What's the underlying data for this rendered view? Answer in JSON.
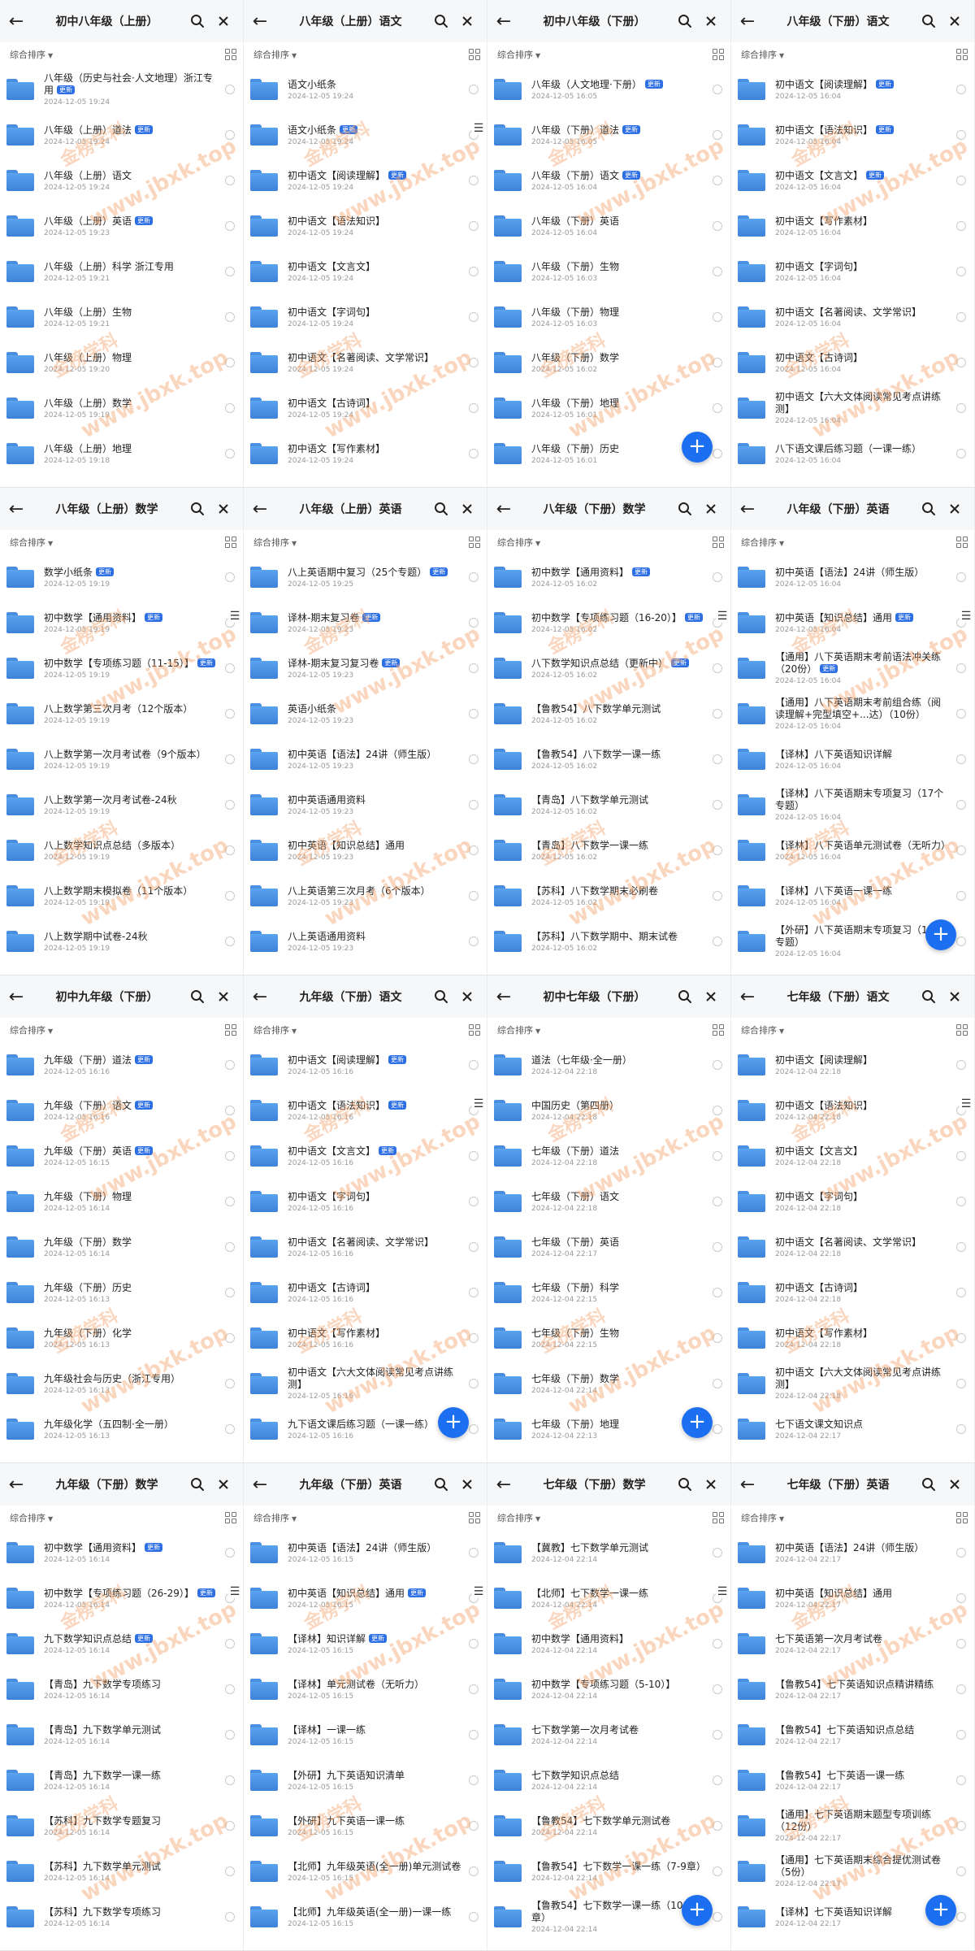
{
  "sort_label": "综合排序",
  "new_badge": "更新",
  "watermark": {
    "primary": "金榜学科",
    "secondary": "www.jbxk.top"
  },
  "panels": [
    {
      "title": "初中八年级（上册）",
      "fab": false,
      "menu": false,
      "items": [
        {
          "name": "八年级（历史与社会·人文地理）浙江专用",
          "date": "2024-12-05 19:24",
          "badge": true
        },
        {
          "name": "八年级（上册）道法",
          "date": "2024-12-05 19:24",
          "badge": true
        },
        {
          "name": "八年级（上册）语文",
          "date": "2024-12-05 19:24",
          "badge": false
        },
        {
          "name": "八年级（上册）英语",
          "date": "2024-12-05 19:23",
          "badge": true
        },
        {
          "name": "八年级（上册）科学 浙江专用",
          "date": "2024-12-05 19:21",
          "badge": false
        },
        {
          "name": "八年级（上册）生物",
          "date": "2024-12-05 19:21",
          "badge": false
        },
        {
          "name": "八年级（上册）物理",
          "date": "2024-12-05 19:20",
          "badge": false
        },
        {
          "name": "八年级（上册）数学",
          "date": "2024-12-05 19:19",
          "badge": false
        },
        {
          "name": "八年级（上册）地理",
          "date": "2024-12-05 19:18",
          "badge": false
        }
      ]
    },
    {
      "title": "八年级（上册）语文",
      "fab": false,
      "menu": true,
      "items": [
        {
          "name": "语文小纸条",
          "date": "2024-12-05 19:24",
          "badge": false
        },
        {
          "name": "语文小纸条",
          "date": "2024-12-05 19:24",
          "badge": true
        },
        {
          "name": "初中语文【阅读理解】",
          "date": "2024-12-05 19:24",
          "badge": true
        },
        {
          "name": "初中语文【语法知识】",
          "date": "2024-12-05 19:24",
          "badge": false
        },
        {
          "name": "初中语文【文言文】",
          "date": "2024-12-05 19:24",
          "badge": false
        },
        {
          "name": "初中语文【字词句】",
          "date": "2024-12-05 19:24",
          "badge": false
        },
        {
          "name": "初中语文【名著阅读、文学常识】",
          "date": "2024-12-05 19:24",
          "badge": false
        },
        {
          "name": "初中语文【古诗词】",
          "date": "2024-12-05 19:24",
          "badge": false
        },
        {
          "name": "初中语文【写作素材】",
          "date": "2024-12-05 19:24",
          "badge": false
        }
      ]
    },
    {
      "title": "初中八年级（下册）",
      "fab": true,
      "menu": false,
      "items": [
        {
          "name": "八年级（人文地理·下册）",
          "date": "2024-12-05 16:05",
          "badge": true
        },
        {
          "name": "八年级（下册）道法",
          "date": "2024-12-05 16:05",
          "badge": true
        },
        {
          "name": "八年级（下册）语文",
          "date": "2024-12-05 16:04",
          "badge": true
        },
        {
          "name": "八年级（下册）英语",
          "date": "2024-12-05 16:04",
          "badge": false
        },
        {
          "name": "八年级（下册）生物",
          "date": "2024-12-05 16:03",
          "badge": false
        },
        {
          "name": "八年级（下册）物理",
          "date": "2024-12-05 16:03",
          "badge": false
        },
        {
          "name": "八年级（下册）数学",
          "date": "2024-12-05 16:02",
          "badge": false
        },
        {
          "name": "八年级（下册）地理",
          "date": "2024-12-05 16:01",
          "badge": false
        },
        {
          "name": "八年级（下册）历史",
          "date": "2024-12-05 16:01",
          "badge": false
        }
      ]
    },
    {
      "title": "八年级（下册）语文",
      "fab": false,
      "menu": false,
      "items": [
        {
          "name": "初中语文【阅读理解】",
          "date": "2024-12-05 16:04",
          "badge": true
        },
        {
          "name": "初中语文【语法知识】",
          "date": "2024-12-05 16:04",
          "badge": true
        },
        {
          "name": "初中语文【文言文】",
          "date": "2024-12-05 16:04",
          "badge": true
        },
        {
          "name": "初中语文【写作素材】",
          "date": "2024-12-05 16:04",
          "badge": false
        },
        {
          "name": "初中语文【字词句】",
          "date": "2024-12-05 16:04",
          "badge": false
        },
        {
          "name": "初中语文【名著阅读、文学常识】",
          "date": "2024-12-05 16:04",
          "badge": false
        },
        {
          "name": "初中语文【古诗词】",
          "date": "2024-12-05 16:04",
          "badge": false
        },
        {
          "name": "初中语文【六大文体阅读常见考点讲练测】",
          "date": "2024-12-05 16:04",
          "badge": false
        },
        {
          "name": "八下语文课后练习题（一课一练）",
          "date": "2024-12-05 16:04",
          "badge": false
        }
      ]
    },
    {
      "title": "八年级（上册）数学",
      "fab": false,
      "menu": true,
      "items": [
        {
          "name": "数学小纸条",
          "date": "2024-12-05 19:19",
          "badge": true
        },
        {
          "name": "初中数学【通用资料】",
          "date": "2024-12-05 19:19",
          "badge": true
        },
        {
          "name": "初中数学【专项练习题（11-15）】",
          "date": "2024-12-05 19:19",
          "badge": true
        },
        {
          "name": "八上数学第三次月考（12个版本）",
          "date": "2024-12-05 19:19",
          "badge": false
        },
        {
          "name": "八上数学第一次月考试卷（9个版本）",
          "date": "2024-12-05 19:19",
          "badge": false
        },
        {
          "name": "八上数学第一次月考试卷-24秋",
          "date": "2024-12-05 19:19",
          "badge": false
        },
        {
          "name": "八上数学知识点总结（多版本）",
          "date": "2024-12-05 19:19",
          "badge": false
        },
        {
          "name": "八上数学期末模拟卷（11个版本）",
          "date": "2024-12-05 19:19",
          "badge": false
        },
        {
          "name": "八上数学期中试卷-24秋",
          "date": "2024-12-05 19:19",
          "badge": false
        }
      ]
    },
    {
      "title": "八年级（上册）英语",
      "fab": false,
      "menu": false,
      "items": [
        {
          "name": "八上英语期中复习（25个专题）",
          "date": "2024-12-05 19:25",
          "badge": true
        },
        {
          "name": "译林-期末复习卷",
          "date": "2024-12-05 19:23",
          "badge": true
        },
        {
          "name": "译林-期末复习复习卷",
          "date": "2024-12-05 19:23",
          "badge": true
        },
        {
          "name": "英语小纸条",
          "date": "2024-12-05 19:23",
          "badge": false
        },
        {
          "name": "初中英语【语法】24讲（师生版）",
          "date": "2024-12-05 19:23",
          "badge": false
        },
        {
          "name": "初中英语通用资料",
          "date": "2024-12-05 19:23",
          "badge": false
        },
        {
          "name": "初中英语【知识总结】通用",
          "date": "2024-12-05 19:23",
          "badge": false
        },
        {
          "name": "八上英语第三次月考（6个版本）",
          "date": "2024-12-05 19:23",
          "badge": false
        },
        {
          "name": "八上英语通用资料",
          "date": "2024-12-05 19:23",
          "badge": false
        }
      ]
    },
    {
      "title": "八年级（下册）数学",
      "fab": false,
      "menu": true,
      "items": [
        {
          "name": "初中数学【通用资料】",
          "date": "2024-12-05 16:02",
          "badge": true
        },
        {
          "name": "初中数学【专项练习题（16-20）】",
          "date": "2024-12-05 16:02",
          "badge": true
        },
        {
          "name": "八下数学知识点总结（更新中）",
          "date": "2024-12-05 16:02",
          "badge": true
        },
        {
          "name": "【鲁教54】八下数学单元测试",
          "date": "2024-12-05 16:02",
          "badge": false
        },
        {
          "name": "【鲁教54】八下数学一课一练",
          "date": "2024-12-05 16:02",
          "badge": false
        },
        {
          "name": "【青岛】八下数学单元测试",
          "date": "2024-12-05 16:02",
          "badge": false
        },
        {
          "name": "【青岛】八下数学一课一练",
          "date": "2024-12-05 16:02",
          "badge": false
        },
        {
          "name": "【苏科】八下数学期末必刷卷",
          "date": "2024-12-05 16:02",
          "badge": false
        },
        {
          "name": "【苏科】八下数学期中、期末试卷",
          "date": "2024-12-05 16:02",
          "badge": false
        }
      ]
    },
    {
      "title": "八年级（下册）英语",
      "fab": true,
      "menu": true,
      "items": [
        {
          "name": "初中英语【语法】24讲（师生版）",
          "date": "2024-12-05 16:04",
          "badge": false
        },
        {
          "name": "初中英语【知识总结】通用",
          "date": "2024-12-05 16:04",
          "badge": true
        },
        {
          "name": "【通用】八下英语期末考前语法冲关练（20份）",
          "date": "2024-12-05 16:04",
          "badge": true
        },
        {
          "name": "【通用】八下英语期末考前组合练（阅读理解+完型填空+...达）（10份）",
          "date": "2024-12-05 16:04",
          "badge": false
        },
        {
          "name": "【译林】八下英语知识详解",
          "date": "2024-12-05 16:04",
          "badge": false
        },
        {
          "name": "【译林】八下英语期末专项复习（17个专题）",
          "date": "2024-12-05 16:04",
          "badge": false
        },
        {
          "name": "【译林】八下英语单元测试卷（无听力）",
          "date": "2024-12-05 16:04",
          "badge": false
        },
        {
          "name": "【译林】八下英语一课一练",
          "date": "2024-12-05 16:04",
          "badge": false
        },
        {
          "name": "【外研】八下英语期末专项复习（16个专题）",
          "date": "2024-12-05 16:04",
          "badge": false
        }
      ]
    },
    {
      "title": "初中九年级（下册）",
      "fab": false,
      "menu": false,
      "items": [
        {
          "name": "九年级（下册）道法",
          "date": "2024-12-05 16:16",
          "badge": true
        },
        {
          "name": "九年级（下册）语文",
          "date": "2024-12-05 16:16",
          "badge": true
        },
        {
          "name": "九年级（下册）英语",
          "date": "2024-12-05 16:15",
          "badge": true
        },
        {
          "name": "九年级（下册）物理",
          "date": "2024-12-05 16:14",
          "badge": false
        },
        {
          "name": "九年级（下册）数学",
          "date": "2024-12-05 16:14",
          "badge": false
        },
        {
          "name": "九年级（下册）历史",
          "date": "2024-12-05 16:13",
          "badge": false
        },
        {
          "name": "九年级（下册）化学",
          "date": "2024-12-05 16:13",
          "badge": false
        },
        {
          "name": "九年级社会与历史（浙江专用）",
          "date": "2024-12-05 16:13",
          "badge": false
        },
        {
          "name": "九年级化学（五四制·全一册）",
          "date": "2024-12-05 16:13",
          "badge": false
        }
      ]
    },
    {
      "title": "九年级（下册）语文",
      "fab": true,
      "menu": true,
      "items": [
        {
          "name": "初中语文【阅读理解】",
          "date": "2024-12-05 16:16",
          "badge": true
        },
        {
          "name": "初中语文【语法知识】",
          "date": "2024-12-05 16:16",
          "badge": true
        },
        {
          "name": "初中语文【文言文】",
          "date": "2024-12-05 16:16",
          "badge": true
        },
        {
          "name": "初中语文【字词句】",
          "date": "2024-12-05 16:16",
          "badge": false
        },
        {
          "name": "初中语文【名著阅读、文学常识】",
          "date": "2024-12-05 16:16",
          "badge": false
        },
        {
          "name": "初中语文【古诗词】",
          "date": "2024-12-05 16:16",
          "badge": false
        },
        {
          "name": "初中语文【写作素材】",
          "date": "2024-12-05 16:16",
          "badge": false
        },
        {
          "name": "初中语文【六大文体阅读常见考点讲练测】",
          "date": "2024-12-05 16:16",
          "badge": false
        },
        {
          "name": "九下语文课后练习题（一课一练）",
          "date": "2024-12-05 16:16",
          "badge": false
        }
      ]
    },
    {
      "title": "初中七年级（下册）",
      "fab": true,
      "menu": false,
      "items": [
        {
          "name": "道法（七年级·全一册）",
          "date": "2024-12-04 22:18",
          "badge": false
        },
        {
          "name": "中国历史（第四册）",
          "date": "2024-12-04 22:18",
          "badge": false
        },
        {
          "name": "七年级（下册）道法",
          "date": "2024-12-04 22:18",
          "badge": false
        },
        {
          "name": "七年级（下册）语文",
          "date": "2024-12-04 22:18",
          "badge": false
        },
        {
          "name": "七年级（下册）英语",
          "date": "2024-12-04 22:17",
          "badge": false
        },
        {
          "name": "七年级（下册）科学",
          "date": "2024-12-04 22:15",
          "badge": false
        },
        {
          "name": "七年级（下册）生物",
          "date": "2024-12-04 22:15",
          "badge": false
        },
        {
          "name": "七年级（下册）数学",
          "date": "2024-12-04 22:14",
          "badge": false
        },
        {
          "name": "七年级（下册）地理",
          "date": "2024-12-04 22:13",
          "badge": false
        }
      ]
    },
    {
      "title": "七年级（下册）语文",
      "fab": false,
      "menu": true,
      "items": [
        {
          "name": "初中语文【阅读理解】",
          "date": "2024-12-04 22:18",
          "badge": false
        },
        {
          "name": "初中语文【语法知识】",
          "date": "2024-12-04 22:18",
          "badge": false
        },
        {
          "name": "初中语文【文言文】",
          "date": "2024-12-04 22:18",
          "badge": false
        },
        {
          "name": "初中语文【字词句】",
          "date": "2024-12-04 22:18",
          "badge": false
        },
        {
          "name": "初中语文【名著阅读、文学常识】",
          "date": "2024-12-04 22:18",
          "badge": false
        },
        {
          "name": "初中语文【古诗词】",
          "date": "2024-12-04 22:18",
          "badge": false
        },
        {
          "name": "初中语文【写作素材】",
          "date": "2024-12-04 22:18",
          "badge": false
        },
        {
          "name": "初中语文【六大文体阅读常见考点讲练测】",
          "date": "2024-12-04 22:18",
          "badge": false
        },
        {
          "name": "七下语文课文知识点",
          "date": "2024-12-04 22:17",
          "badge": false
        }
      ]
    },
    {
      "title": "九年级（下册）数学",
      "fab": false,
      "menu": true,
      "items": [
        {
          "name": "初中数学【通用资料】",
          "date": "2024-12-05 16:14",
          "badge": true
        },
        {
          "name": "初中数学【专项练习题（26-29）】",
          "date": "2024-12-05 16:14",
          "badge": true
        },
        {
          "name": "九下数学知识点总结",
          "date": "2024-12-05 16:14",
          "badge": true
        },
        {
          "name": "【青岛】九下数学专项练习",
          "date": "2024-12-05 16:14",
          "badge": false
        },
        {
          "name": "【青岛】九下数学单元测试",
          "date": "2024-12-05 16:14",
          "badge": false
        },
        {
          "name": "【青岛】九下数学一课一练",
          "date": "2024-12-05 16:14",
          "badge": false
        },
        {
          "name": "【苏科】九下数学专题复习",
          "date": "2024-12-05 16:14",
          "badge": false
        },
        {
          "name": "【苏科】九下数学单元测试",
          "date": "2024-12-05 16:14",
          "badge": false
        },
        {
          "name": "【苏科】九下数学专项练习",
          "date": "2024-12-05 16:14",
          "badge": false
        }
      ]
    },
    {
      "title": "九年级（下册）英语",
      "fab": false,
      "menu": true,
      "items": [
        {
          "name": "初中英语【语法】24讲（师生版）",
          "date": "2024-12-05 16:15",
          "badge": false
        },
        {
          "name": "初中英语【知识总结】通用",
          "date": "2024-12-05 16:15",
          "badge": true
        },
        {
          "name": "【译林】知识详解",
          "date": "2024-12-05 16:15",
          "badge": true
        },
        {
          "name": "【译林】单元测试卷（无听力）",
          "date": "2024-12-05 16:15",
          "badge": false
        },
        {
          "name": "【译林】一课一练",
          "date": "2024-12-05 16:15",
          "badge": false
        },
        {
          "name": "【外研】九下英语知识清单",
          "date": "2024-12-05 16:15",
          "badge": false
        },
        {
          "name": "【外研】九下英语一课一练",
          "date": "2024-12-05 16:15",
          "badge": false
        },
        {
          "name": "【北师】九年级英语(全一册)单元测试卷",
          "date": "2024-12-05 16:15",
          "badge": false
        },
        {
          "name": "【北师】九年级英语(全一册)一课一练",
          "date": "2024-12-05 16:15",
          "badge": false
        }
      ]
    },
    {
      "title": "七年级（下册）数学",
      "fab": true,
      "menu": true,
      "items": [
        {
          "name": "【冀教】七下数学单元测试",
          "date": "2024-12-04 22:14",
          "badge": false
        },
        {
          "name": "【北师】七下数学一课一练",
          "date": "2024-12-04 22:14",
          "badge": false
        },
        {
          "name": "初中数学【通用资料】",
          "date": "2024-12-04 22:14",
          "badge": false
        },
        {
          "name": "初中数学【专项练习题（5-10）】",
          "date": "2024-12-04 22:14",
          "badge": false
        },
        {
          "name": "七下数学第一次月考试卷",
          "date": "2024-12-04 22:14",
          "badge": false
        },
        {
          "name": "七下数学知识点总结",
          "date": "2024-12-04 22:14",
          "badge": false
        },
        {
          "name": "【鲁教54】七下数学单元测试卷",
          "date": "2024-12-04 22:14",
          "badge": false
        },
        {
          "name": "【鲁教54】七下数学一课一练（7-9章）",
          "date": "2024-12-04 22:14",
          "badge": false
        },
        {
          "name": "【鲁教54】七下数学一课一练（10-11章）",
          "date": "2024-12-04 22:14",
          "badge": false
        }
      ]
    },
    {
      "title": "七年级（下册）英语",
      "fab": true,
      "menu": false,
      "items": [
        {
          "name": "初中英语【语法】24讲（师生版）",
          "date": "2024-12-04 22:17",
          "badge": false
        },
        {
          "name": "初中英语【知识总结】通用",
          "date": "2024-12-04 22:17",
          "badge": false
        },
        {
          "name": "七下英语第一次月考试卷",
          "date": "2024-12-04 22:17",
          "badge": false
        },
        {
          "name": "【鲁教54】七下英语知识点精讲精练",
          "date": "2024-12-04 22:17",
          "badge": false
        },
        {
          "name": "【鲁教54】七下英语知识点总结",
          "date": "2024-12-04 22:17",
          "badge": false
        },
        {
          "name": "【鲁教54】七下英语一课一练",
          "date": "2024-12-04 22:17",
          "badge": false
        },
        {
          "name": "【通用】七下英语期末题型专项训练（12份）",
          "date": "2024-12-04 22:17",
          "badge": false
        },
        {
          "name": "【通用】七下英语期末综合提优测试卷（5份）",
          "date": "2024-12-04 22:17",
          "badge": false
        },
        {
          "name": "【译林】七下英语知识详解",
          "date": "2024-12-04 22:17",
          "badge": false
        }
      ]
    }
  ]
}
